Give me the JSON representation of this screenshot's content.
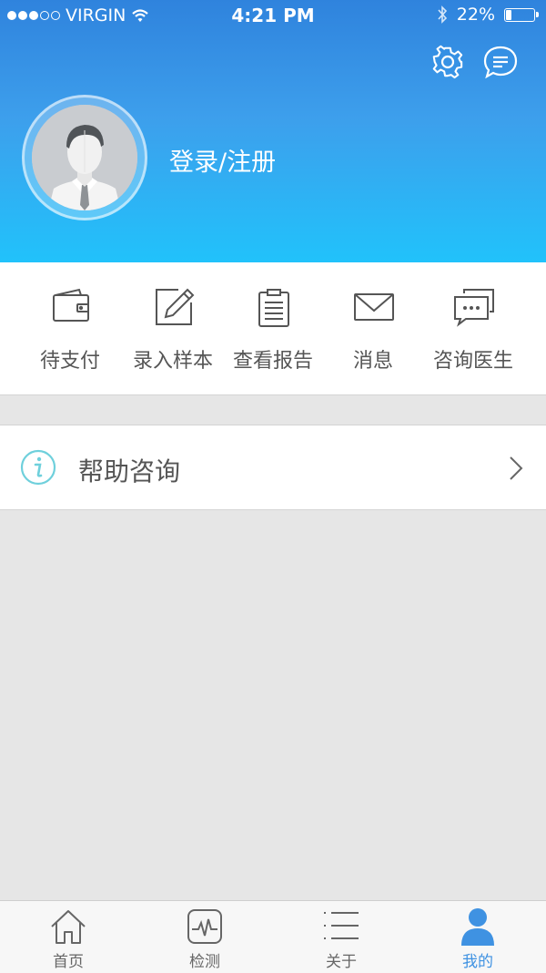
{
  "status_bar": {
    "carrier": "VIRGIN",
    "signal_bars": 3,
    "time": "4:21 PM",
    "battery": "22%",
    "battery_level": 0.22
  },
  "header": {
    "settings_icon": "gear-icon",
    "message_icon": "chat-bubble-icon",
    "login_label": "登录/注册"
  },
  "menu": [
    {
      "label": "待支付",
      "icon": "wallet-icon"
    },
    {
      "label": "录入样本",
      "icon": "edit-icon"
    },
    {
      "label": "查看报告",
      "icon": "clipboard-icon"
    },
    {
      "label": "消息",
      "icon": "envelope-icon"
    },
    {
      "label": "咨询医生",
      "icon": "chat-icon"
    }
  ],
  "help": {
    "label": "帮助咨询",
    "icon": "info-icon"
  },
  "tabs": [
    {
      "label": "首页",
      "icon": "home-icon"
    },
    {
      "label": "检测",
      "icon": "pulse-icon"
    },
    {
      "label": "关于",
      "icon": "list-icon"
    },
    {
      "label": "我的",
      "icon": "user-icon"
    }
  ],
  "colors": {
    "header_top": "#2f83dd",
    "header_bottom": "#21c2fb",
    "accent": "#3f92e2",
    "info_icon": "#6fd0dc"
  }
}
